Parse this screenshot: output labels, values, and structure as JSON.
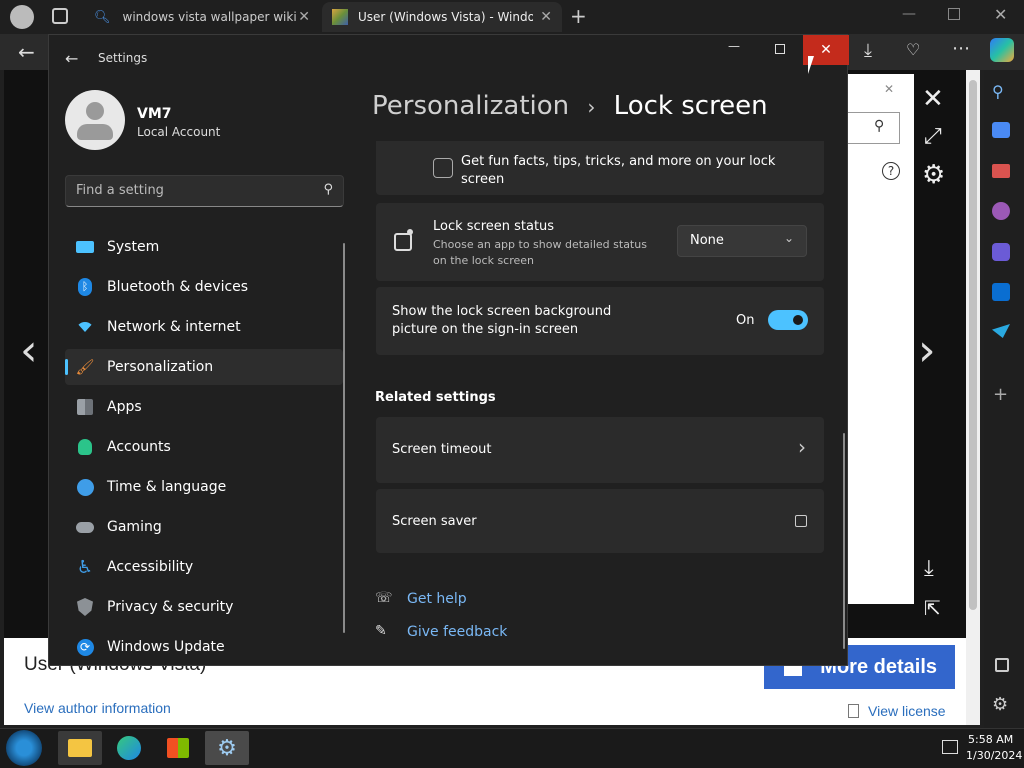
{
  "browser": {
    "tabs": [
      {
        "label": "windows vista wallpaper wiki - Se"
      },
      {
        "label": "User (Windows Vista) - Windows"
      }
    ]
  },
  "webpage": {
    "title": "User (Windows Vista)",
    "author_link": "View author information",
    "license_link": "View license",
    "more_details": "More details"
  },
  "settings": {
    "app_title": "Settings",
    "user": {
      "name": "VM7",
      "account_type": "Local Account"
    },
    "search_placeholder": "Find a setting",
    "nav": [
      {
        "label": "System"
      },
      {
        "label": "Bluetooth & devices"
      },
      {
        "label": "Network & internet"
      },
      {
        "label": "Personalization"
      },
      {
        "label": "Apps"
      },
      {
        "label": "Accounts"
      },
      {
        "label": "Time & language"
      },
      {
        "label": "Gaming"
      },
      {
        "label": "Accessibility"
      },
      {
        "label": "Privacy & security"
      },
      {
        "label": "Windows Update"
      }
    ],
    "breadcrumb": {
      "parent": "Personalization",
      "separator": "›",
      "current": "Lock screen"
    },
    "fun_facts_label": "Get fun facts, tips, tricks, and more on your lock screen",
    "lock_status": {
      "title": "Lock screen status",
      "desc": "Choose an app to show detailed status on the lock screen",
      "value": "None"
    },
    "signin_bg": {
      "label": "Show the lock screen background picture on the sign-in screen",
      "state_label": "On"
    },
    "related_heading": "Related settings",
    "related": [
      {
        "label": "Screen timeout"
      },
      {
        "label": "Screen saver"
      }
    ],
    "help": {
      "get_help": "Get help",
      "give_feedback": "Give feedback"
    }
  },
  "taskbar": {
    "time": "5:58 AM",
    "date": "1/30/2024"
  },
  "colors": {
    "accent": "#4cc2ff",
    "close_red": "#c42b1c",
    "link_blue": "#2a6ebd"
  }
}
